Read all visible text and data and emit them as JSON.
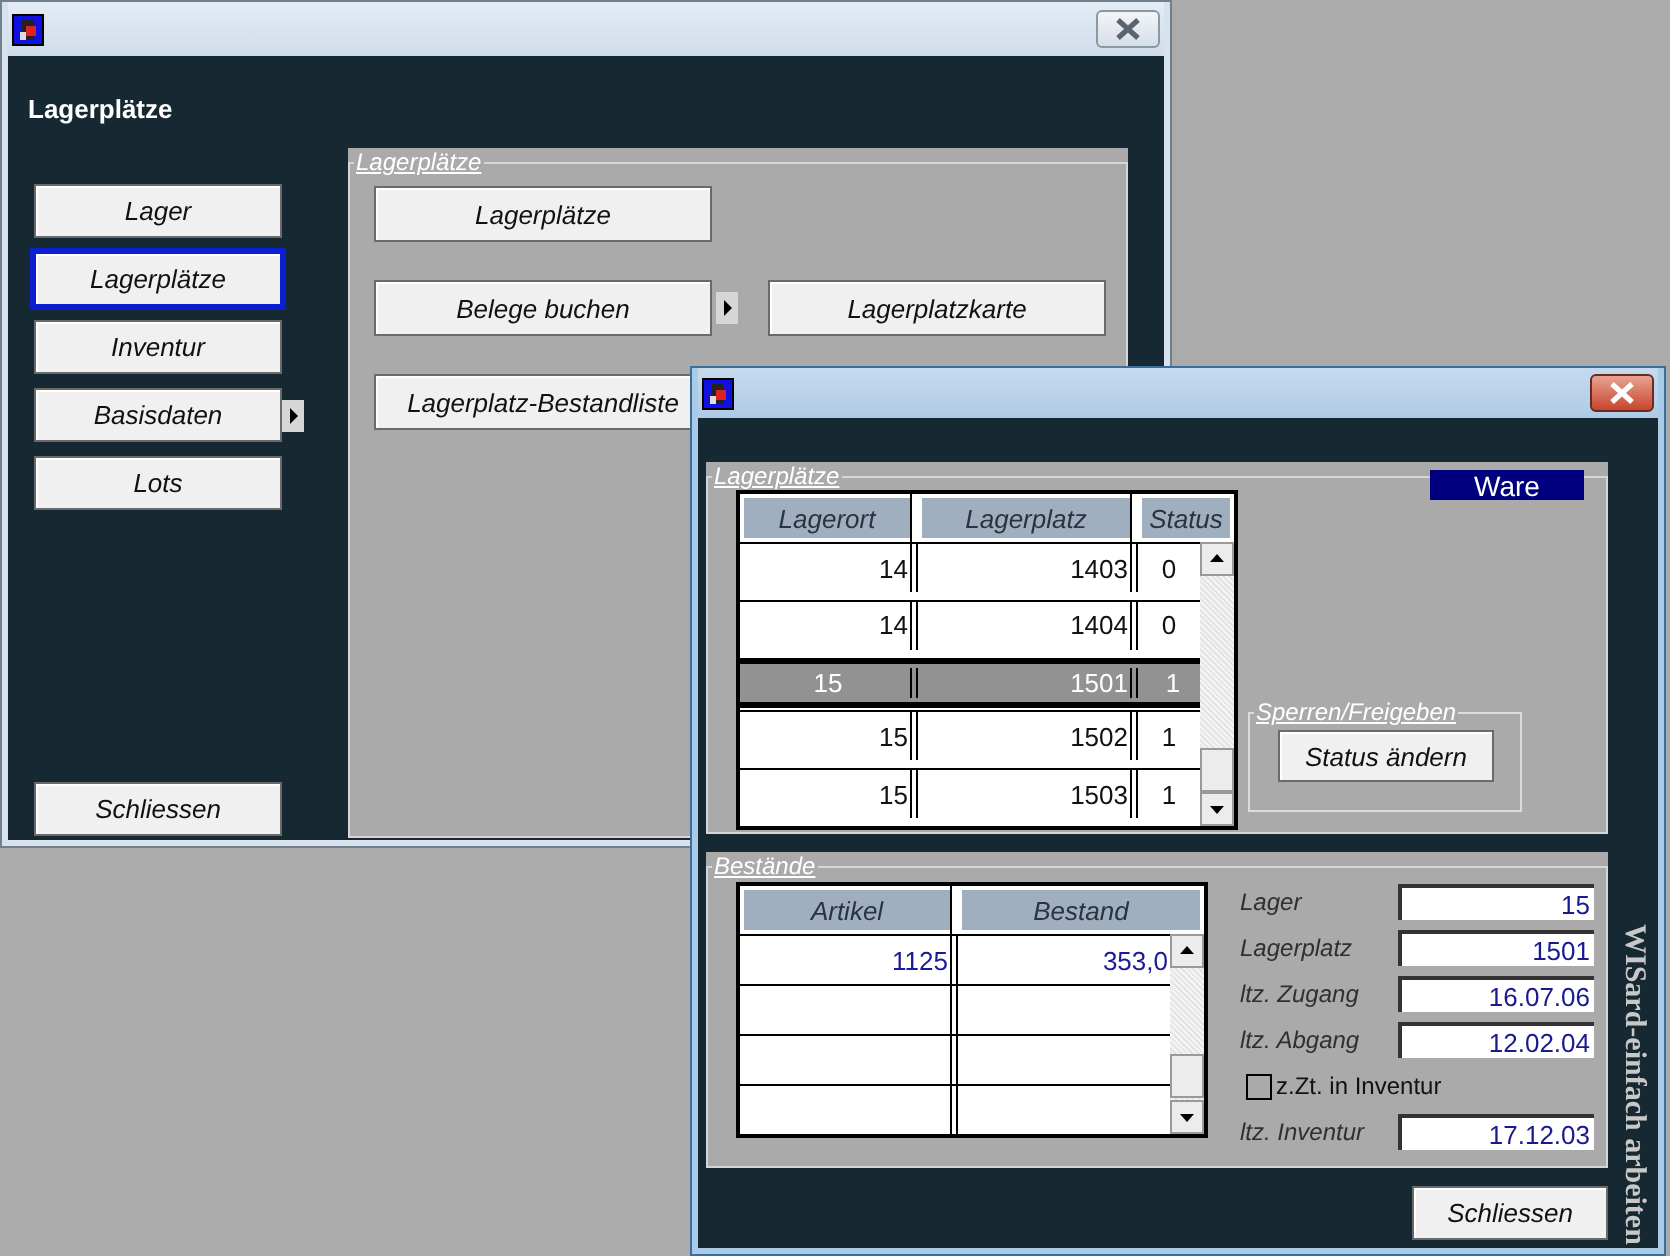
{
  "main_window": {
    "active": false,
    "heading": "Lagerplätze",
    "nav": [
      {
        "label": "Lager",
        "selected": false,
        "submenu": false
      },
      {
        "label": "Lagerplätze",
        "selected": true,
        "submenu": false
      },
      {
        "label": "Inventur",
        "selected": false,
        "submenu": false
      },
      {
        "label": "Basisdaten",
        "selected": false,
        "submenu": true
      },
      {
        "label": "Lots",
        "selected": false,
        "submenu": false
      }
    ],
    "close_button": "Schliessen",
    "panel": {
      "title": "Lagerplätze",
      "rows": [
        {
          "buttons": [
            {
              "label": "Lagerplätze",
              "submenu": false
            }
          ]
        },
        {
          "buttons": [
            {
              "label": "Belege buchen",
              "submenu": true
            },
            {
              "label": "Lagerplatzkarte",
              "submenu": false
            }
          ]
        },
        {
          "buttons": [
            {
              "label": "Lagerplatz-Bestandliste",
              "submenu": false
            }
          ]
        }
      ]
    }
  },
  "detail_window": {
    "active": true,
    "locations": {
      "title": "Lagerplätze",
      "badge": "Ware",
      "columns": [
        "Lagerort",
        "Lagerplatz",
        "Status"
      ],
      "rows": [
        {
          "cells": [
            "14",
            "1403",
            "0"
          ],
          "selected": false
        },
        {
          "cells": [
            "14",
            "1404",
            "0"
          ],
          "selected": false
        },
        {
          "cells": [
            "15",
            "1501",
            "1"
          ],
          "selected": true
        },
        {
          "cells": [
            "15",
            "1502",
            "1"
          ],
          "selected": false
        },
        {
          "cells": [
            "15",
            "1503",
            "1"
          ],
          "selected": false
        }
      ]
    },
    "status_group": {
      "title": "Sperren/Freigeben",
      "button": "Status ändern"
    },
    "stock": {
      "title": "Bestände",
      "columns": [
        "Artikel",
        "Bestand"
      ],
      "rows": [
        {
          "cells": [
            "1125",
            "353,0"
          ]
        }
      ],
      "form": [
        {
          "kind": "field",
          "label": "Lager",
          "value": "15"
        },
        {
          "kind": "field",
          "label": "Lagerplatz",
          "value": "1501"
        },
        {
          "kind": "field",
          "label": "ltz. Zugang",
          "value": "16.07.06"
        },
        {
          "kind": "field",
          "label": "ltz. Abgang",
          "value": "12.02.04"
        },
        {
          "kind": "checkbox",
          "label": "z.Zt. in Inventur",
          "checked": false
        },
        {
          "kind": "field",
          "label": "ltz. Inventur",
          "value": "17.12.03"
        }
      ]
    },
    "close_button": "Schliessen",
    "side_text": "WISard-einfach arbeiten"
  }
}
